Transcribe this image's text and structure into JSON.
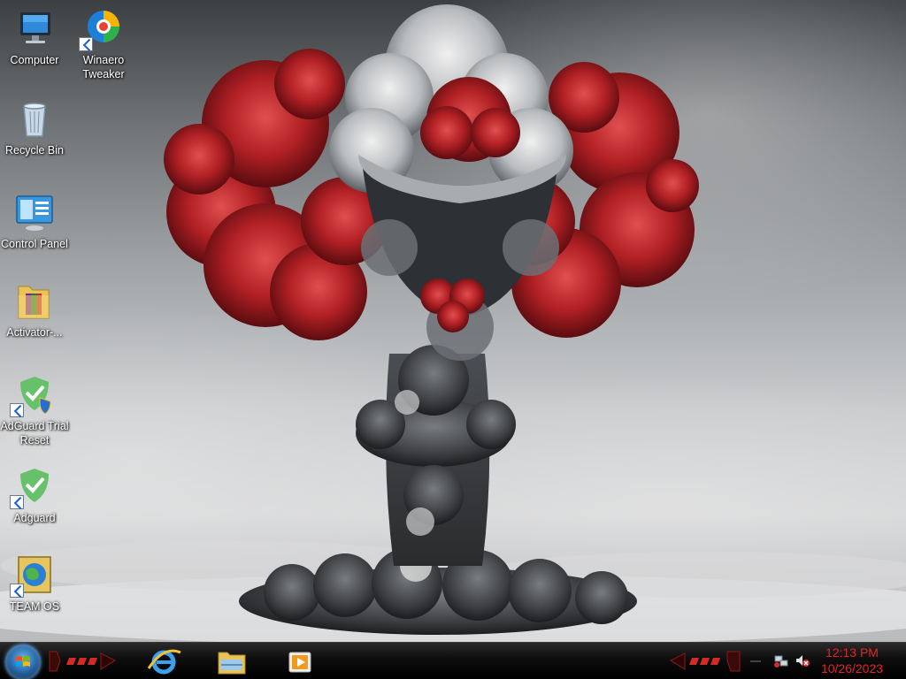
{
  "desktop": {
    "icons": [
      {
        "label": "Computer",
        "icon": "computer-icon"
      },
      {
        "label": "Winaero Tweaker",
        "icon": "winaero-tweaker-icon"
      },
      {
        "label": "Recycle Bin",
        "icon": "recycle-bin-icon"
      },
      {
        "label": "Control Panel",
        "icon": "control-panel-icon"
      },
      {
        "label": "Activator-...",
        "icon": "folder-icon"
      },
      {
        "label": "AdGuard Trial Reset",
        "icon": "adguard-trial-reset-icon"
      },
      {
        "label": "Adguard",
        "icon": "adguard-icon"
      },
      {
        "label": "TEAM OS",
        "icon": "team-os-icon"
      }
    ]
  },
  "taskbar": {
    "start": "windows-start-orb",
    "pinned": [
      {
        "icon": "internet-explorer-icon"
      },
      {
        "icon": "file-explorer-icon"
      },
      {
        "icon": "media-player-icon"
      }
    ],
    "tray": {
      "time": "12:13 PM",
      "date": "10/26/2023",
      "clock_color": "#e32424",
      "icons": [
        "network-icon",
        "volume-muted-icon"
      ]
    }
  },
  "theme": {
    "accent_red": "#d42a2a",
    "taskbar_bg": "#000000"
  }
}
